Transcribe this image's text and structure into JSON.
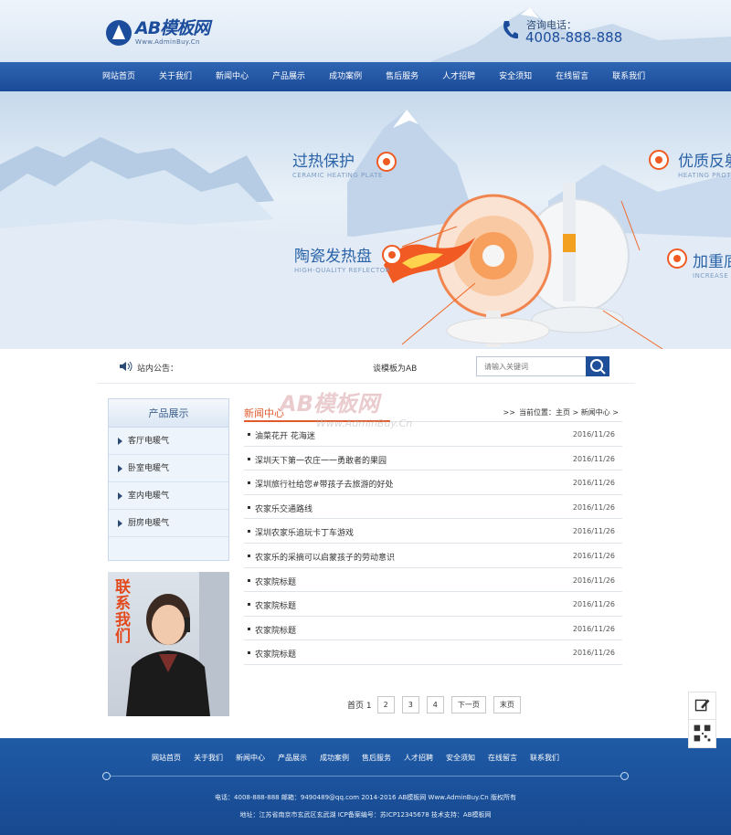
{
  "logo": {
    "name": "AB模板网",
    "sub": "Www.AdminBuy.Cn"
  },
  "hotline": {
    "label": "咨询电话：",
    "number": "4008-888-888"
  },
  "nav": [
    "网站首页",
    "关于我们",
    "新闻中心",
    "产品展示",
    "成功案例",
    "售后服务",
    "人才招聘",
    "安全须知",
    "在线留言",
    "联系我们"
  ],
  "banner": {
    "features": [
      {
        "title": "过热保护",
        "sub": "CERAMIC HEATING PLATE"
      },
      {
        "title": "陶瓷发热盘",
        "sub": "HIGH-QUALITY REFLECTOR"
      },
      {
        "title": "优质反射",
        "sub": "HEATING PROTECTION"
      },
      {
        "title": "加重底",
        "sub": "INCREASE BASE"
      }
    ]
  },
  "notice": {
    "label": "站内公告：",
    "message": "谈模板为AB"
  },
  "search": {
    "placeholder": "请输入关键词"
  },
  "sidebar": {
    "title": "产品展示",
    "items": [
      "客厅电暖气",
      "卧室电暖气",
      "室内电暖气",
      "厨房电暖气"
    ]
  },
  "contact_banner": {
    "text": "联系我们"
  },
  "news": {
    "title": "新闻中心",
    "breadcrumb": "当前位置：主页 > 新闻中心 >",
    "items": [
      {
        "title": "油菜花开 花海迷",
        "date": "2016/11/26"
      },
      {
        "title": "深圳天下第一农庄一一勇敢者的果园",
        "date": "2016/11/26"
      },
      {
        "title": "深圳旅行社给您#带孩子去旅游的好处",
        "date": "2016/11/26"
      },
      {
        "title": "农家乐交通路线",
        "date": "2016/11/26"
      },
      {
        "title": "深圳农家乐追玩卡丁车游戏",
        "date": "2016/11/26"
      },
      {
        "title": "农家乐的采摘可以启蒙孩子的劳动意识",
        "date": "2016/11/26"
      },
      {
        "title": "农家院标题",
        "date": "2016/11/26"
      },
      {
        "title": "农家院标题",
        "date": "2016/11/26"
      },
      {
        "title": "农家院标题",
        "date": "2016/11/26"
      },
      {
        "title": "农家院标题",
        "date": "2016/11/26"
      }
    ]
  },
  "watermark": {
    "big": "AB模板网",
    "small": "Www.AdminBuy.Cn"
  },
  "pagination": {
    "label": "首页 1",
    "pages": [
      "2",
      "3",
      "4"
    ],
    "next": "下一页",
    "last": "末页"
  },
  "footer": {
    "nav": [
      "网站首页",
      "关于我们",
      "新闻中心",
      "产品展示",
      "成功案例",
      "售后服务",
      "人才招聘",
      "安全须知",
      "在线留言",
      "联系我们"
    ],
    "line1": "电话：4008-888-888    邮箱：9490489@qq.com    2014-2016 AB模板网 Www.AdminBuy.Cn 版权所有",
    "line2": "地址：江苏省南京市玄武区玄武湖    ICP备案编号：苏ICP12345678    技术支持：AB模板网"
  },
  "colors": {
    "primary": "#1c4d9c",
    "accent": "#e05a2b",
    "nav": "#2f66b3"
  }
}
